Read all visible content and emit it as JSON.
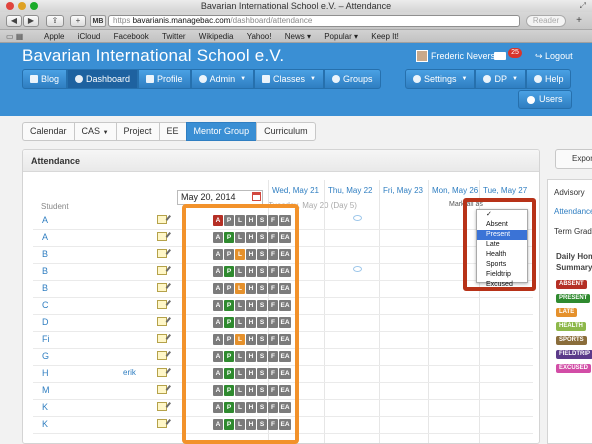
{
  "browser": {
    "window_title": "Bavarian International School e.V. – Attendance",
    "url_host": "bavarianis.managebac.com",
    "url_path": "/dashboard/attendance",
    "url_prefix": "https",
    "mb_badge": "MB",
    "reader_label": "Reader",
    "bookmarks": [
      "Apple",
      "iCloud",
      "Facebook",
      "Twitter",
      "Wikipedia",
      "Yahoo!",
      "News ▾",
      "Popular ▾",
      "Keep It!"
    ]
  },
  "site": {
    "school_name": "Bavarian International School e.V.",
    "user_name": "Frederic Nevers",
    "mail_count": "25",
    "logout_label": "Logout",
    "nav": [
      "Blog",
      "Dashboard",
      "Profile",
      "Admin",
      "Classes",
      "Groups"
    ],
    "nav_right": [
      "Settings",
      "DP",
      "Help"
    ],
    "users_label": "Users"
  },
  "subtabs": [
    "Calendar",
    "CAS",
    "Project",
    "EE",
    "Mentor Group",
    "Curriculum"
  ],
  "attendance": {
    "title": "Attendance",
    "date_value": "May 20, 2014",
    "student_header": "Student",
    "days": [
      "Wed, May 21",
      "Thu, May 22",
      "Fri, May 23",
      "Mon, May 26",
      "Tue, May 27"
    ],
    "day_subheading": "Tuesday, May 20 (Day 5)",
    "mark_all": "Mark all as",
    "codes": [
      "A",
      "P",
      "L",
      "H",
      "S",
      "F",
      "EA"
    ],
    "students": [
      {
        "initial": "A",
        "suffix": "",
        "status": "A"
      },
      {
        "initial": "A",
        "suffix": "",
        "status": "P"
      },
      {
        "initial": "B",
        "suffix": "",
        "status": "L"
      },
      {
        "initial": "B",
        "suffix": "",
        "status": "P"
      },
      {
        "initial": "B",
        "suffix": "",
        "status": "L"
      },
      {
        "initial": "C",
        "suffix": "",
        "status": "P"
      },
      {
        "initial": "D",
        "suffix": "",
        "status": "P"
      },
      {
        "initial": "Fi",
        "suffix": "",
        "status": "L"
      },
      {
        "initial": "G",
        "suffix": "",
        "status": "P"
      },
      {
        "initial": "H",
        "suffix": "erik",
        "status": "P"
      },
      {
        "initial": "M",
        "suffix": "",
        "status": "P"
      },
      {
        "initial": "K",
        "suffix": "",
        "status": "P"
      },
      {
        "initial": "K",
        "suffix": "",
        "status": "P"
      }
    ],
    "dropdown_options": [
      "✓",
      "Absent",
      "Present",
      "Late",
      "Health",
      "Sports",
      "Fieldtrip",
      "Excused"
    ],
    "dropdown_selected": "Present"
  },
  "colors": {
    "A": "#b52f25",
    "P": "#2f8a2f",
    "L": "#e5912c",
    "off": "#7b7b7b",
    "brand": "#3a8fd4"
  },
  "sidebar": {
    "export_label": "Export",
    "advisory_label": "Advisory",
    "attendance_label": "Attendance",
    "term_label": "Term Grades",
    "summary_heading_1": "Daily Home",
    "summary_heading_2": "Summary",
    "legend": [
      {
        "label": "ABSENT",
        "color": "#b52f25"
      },
      {
        "label": "PRESENT",
        "color": "#2f8a2f"
      },
      {
        "label": "LATE",
        "color": "#e5912c"
      },
      {
        "label": "HEALTH",
        "color": "#8db84a"
      },
      {
        "label": "SPORTS",
        "color": "#8a6d3b"
      },
      {
        "label": "FIELDTRIP",
        "color": "#5b3a8a"
      },
      {
        "label": "EXCUSED",
        "color": "#d24da6"
      }
    ]
  }
}
